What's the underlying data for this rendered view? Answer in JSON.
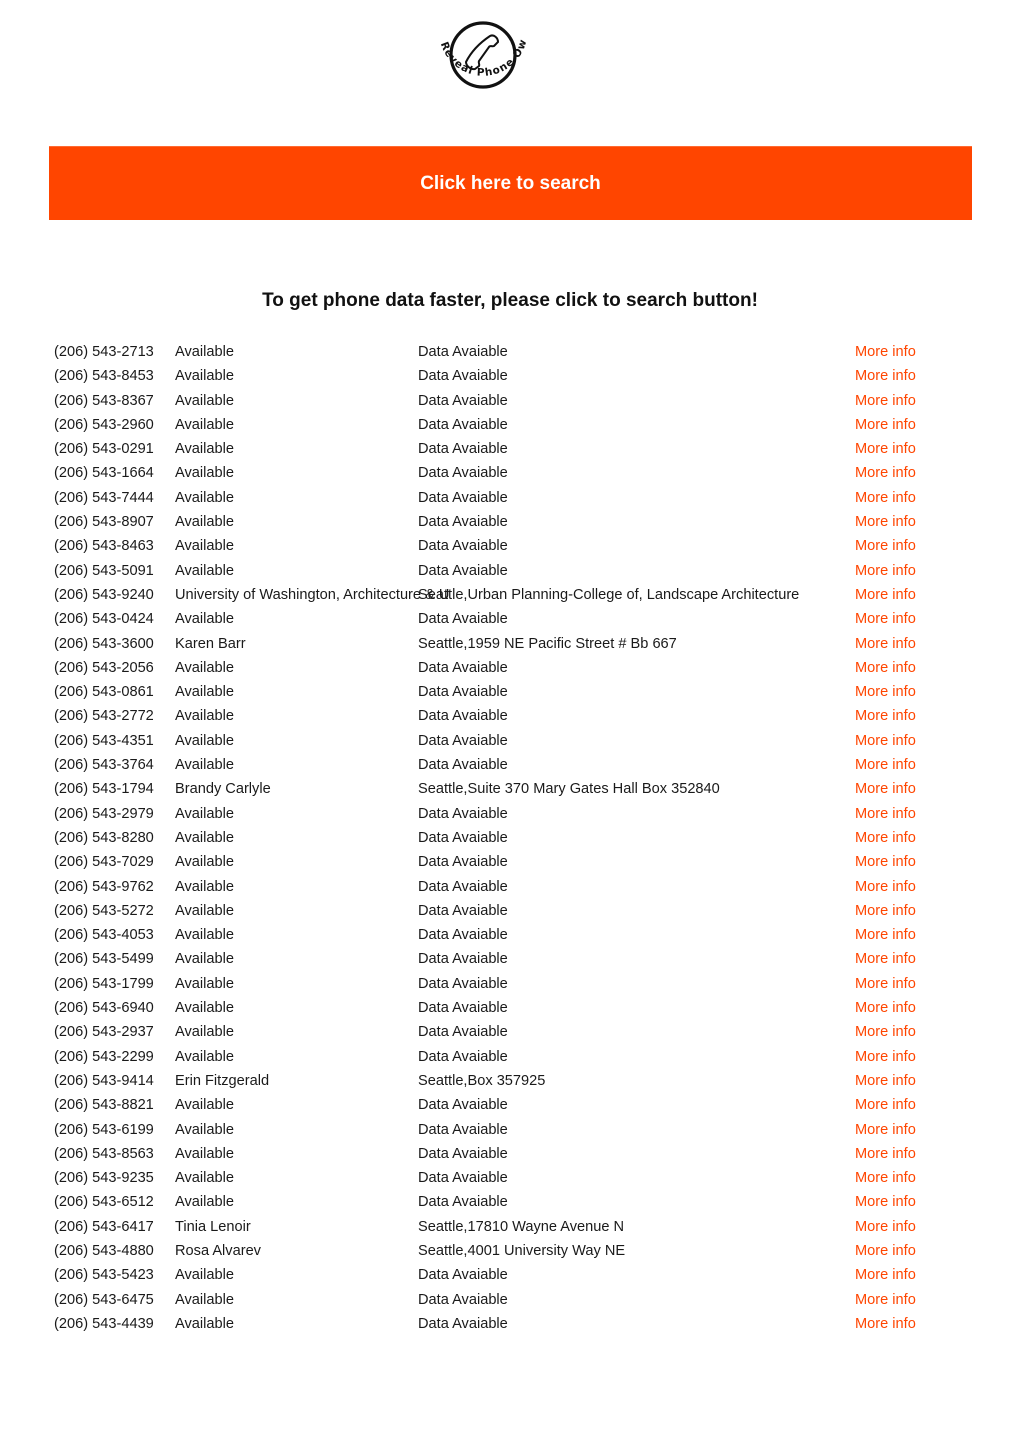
{
  "logo": {
    "icon": "phone-handset-icon",
    "text": "Reveal Phone Owner"
  },
  "search_banner": {
    "label": "Click here to search",
    "color": "#ff4500"
  },
  "headline": "To get phone data faster, please click to search button!",
  "link_color": "#ff4500",
  "rows": [
    {
      "phone": "(206) 543-2713",
      "name": "Available",
      "address": "Data Avaiable",
      "link": "More info"
    },
    {
      "phone": "(206) 543-8453",
      "name": "Available",
      "address": "Data Avaiable",
      "link": "More info"
    },
    {
      "phone": "(206) 543-8367",
      "name": "Available",
      "address": "Data Avaiable",
      "link": "More info"
    },
    {
      "phone": "(206) 543-2960",
      "name": "Available",
      "address": "Data Avaiable",
      "link": "More info"
    },
    {
      "phone": "(206) 543-0291",
      "name": "Available",
      "address": "Data Avaiable",
      "link": "More info"
    },
    {
      "phone": "(206) 543-1664",
      "name": "Available",
      "address": "Data Avaiable",
      "link": "More info"
    },
    {
      "phone": "(206) 543-7444",
      "name": "Available",
      "address": "Data Avaiable",
      "link": "More info"
    },
    {
      "phone": "(206) 543-8907",
      "name": "Available",
      "address": "Data Avaiable",
      "link": "More info"
    },
    {
      "phone": "(206) 543-8463",
      "name": "Available",
      "address": "Data Avaiable",
      "link": "More info"
    },
    {
      "phone": "(206) 543-5091",
      "name": "Available",
      "address": "Data Avaiable",
      "link": "More info"
    },
    {
      "phone": "(206) 543-9240",
      "name": "University of Washington, Architecture & U",
      "address": "Seattle,Urban Planning-College of, Landscape Architecture",
      "link": "More info"
    },
    {
      "phone": "(206) 543-0424",
      "name": "Available",
      "address": "Data Avaiable",
      "link": "More info"
    },
    {
      "phone": "(206) 543-3600",
      "name": "Karen Barr",
      "address": "Seattle,1959 NE Pacific Street # Bb 667",
      "link": "More info"
    },
    {
      "phone": "(206) 543-2056",
      "name": "Available",
      "address": "Data Avaiable",
      "link": "More info"
    },
    {
      "phone": "(206) 543-0861",
      "name": "Available",
      "address": "Data Avaiable",
      "link": "More info"
    },
    {
      "phone": "(206) 543-2772",
      "name": "Available",
      "address": "Data Avaiable",
      "link": "More info"
    },
    {
      "phone": "(206) 543-4351",
      "name": "Available",
      "address": "Data Avaiable",
      "link": "More info"
    },
    {
      "phone": "(206) 543-3764",
      "name": "Available",
      "address": "Data Avaiable",
      "link": "More info"
    },
    {
      "phone": "(206) 543-1794",
      "name": "Brandy Carlyle",
      "address": "Seattle,Suite 370 Mary Gates Hall Box 352840",
      "link": "More info"
    },
    {
      "phone": "(206) 543-2979",
      "name": "Available",
      "address": "Data Avaiable",
      "link": "More info"
    },
    {
      "phone": "(206) 543-8280",
      "name": "Available",
      "address": "Data Avaiable",
      "link": "More info"
    },
    {
      "phone": "(206) 543-7029",
      "name": "Available",
      "address": "Data Avaiable",
      "link": "More info"
    },
    {
      "phone": "(206) 543-9762",
      "name": "Available",
      "address": "Data Avaiable",
      "link": "More info"
    },
    {
      "phone": "(206) 543-5272",
      "name": "Available",
      "address": "Data Avaiable",
      "link": "More info"
    },
    {
      "phone": "(206) 543-4053",
      "name": "Available",
      "address": "Data Avaiable",
      "link": "More info"
    },
    {
      "phone": "(206) 543-5499",
      "name": "Available",
      "address": "Data Avaiable",
      "link": "More info"
    },
    {
      "phone": "(206) 543-1799",
      "name": "Available",
      "address": "Data Avaiable",
      "link": "More info"
    },
    {
      "phone": "(206) 543-6940",
      "name": "Available",
      "address": "Data Avaiable",
      "link": "More info"
    },
    {
      "phone": "(206) 543-2937",
      "name": "Available",
      "address": "Data Avaiable",
      "link": "More info"
    },
    {
      "phone": "(206) 543-2299",
      "name": "Available",
      "address": "Data Avaiable",
      "link": "More info"
    },
    {
      "phone": "(206) 543-9414",
      "name": "Erin Fitzgerald",
      "address": "Seattle,Box 357925",
      "link": "More info"
    },
    {
      "phone": "(206) 543-8821",
      "name": "Available",
      "address": "Data Avaiable",
      "link": "More info"
    },
    {
      "phone": "(206) 543-6199",
      "name": "Available",
      "address": "Data Avaiable",
      "link": "More info"
    },
    {
      "phone": "(206) 543-8563",
      "name": "Available",
      "address": "Data Avaiable",
      "link": "More info"
    },
    {
      "phone": "(206) 543-9235",
      "name": "Available",
      "address": "Data Avaiable",
      "link": "More info"
    },
    {
      "phone": "(206) 543-6512",
      "name": "Available",
      "address": "Data Avaiable",
      "link": "More info"
    },
    {
      "phone": "(206) 543-6417",
      "name": "Tinia Lenoir",
      "address": "Seattle,17810 Wayne Avenue N",
      "link": "More info"
    },
    {
      "phone": "(206) 543-4880",
      "name": "Rosa Alvarev",
      "address": "Seattle,4001 University Way NE",
      "link": "More info"
    },
    {
      "phone": "(206) 543-5423",
      "name": "Available",
      "address": "Data Avaiable",
      "link": "More info"
    },
    {
      "phone": "(206) 543-6475",
      "name": "Available",
      "address": "Data Avaiable",
      "link": "More info"
    },
    {
      "phone": "(206) 543-4439",
      "name": "Available",
      "address": "Data Avaiable",
      "link": "More info"
    }
  ]
}
